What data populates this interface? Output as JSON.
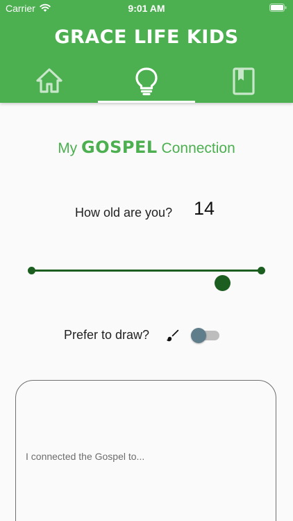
{
  "status_bar": {
    "carrier": "Carrier",
    "time": "9:01 AM"
  },
  "app": {
    "title": "GRACE LIFE KIDS",
    "brand_color": "#4caf50",
    "dark_green": "#1b5e20"
  },
  "tabs": [
    {
      "icon": "home-icon",
      "selected": false
    },
    {
      "icon": "lightbulb-icon",
      "selected": true
    },
    {
      "icon": "book-icon",
      "selected": false
    }
  ],
  "heading": {
    "prefix": "My",
    "emphasis": "GOSPEL",
    "suffix": "Connection"
  },
  "age": {
    "label": "How old are you?",
    "value": "14",
    "slider_fraction": 0.83
  },
  "draw": {
    "label": "Prefer to draw?",
    "icon": "brush-icon",
    "enabled": false
  },
  "connection": {
    "placeholder": "I connected the Gospel to..."
  }
}
